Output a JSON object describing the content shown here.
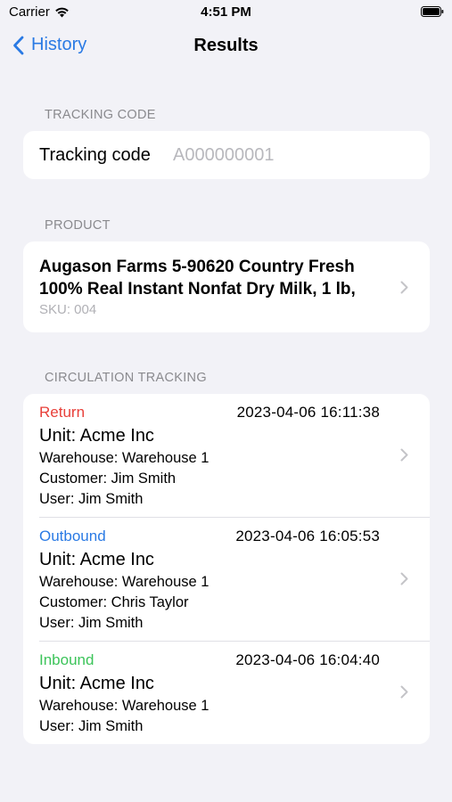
{
  "status_bar": {
    "carrier": "Carrier",
    "time": "4:51 PM"
  },
  "nav": {
    "back_label": "History",
    "title": "Results"
  },
  "tracking_section": {
    "header": "TRACKING CODE",
    "label": "Tracking code",
    "placeholder": "A000000001",
    "value": ""
  },
  "product_section": {
    "header": "PRODUCT",
    "name": "Augason Farms 5-90620 Country Fresh 100% Real Instant Nonfat Dry Milk, 1 lb,",
    "sku": "SKU: 004"
  },
  "circulation_section": {
    "header": "CIRCULATION TRACKING",
    "entries": [
      {
        "type": "Return",
        "type_color": "#e8403a",
        "datetime": "2023-04-06 16:11:38",
        "unit": "Unit:  Acme Inc",
        "warehouse": "Warehouse:  Warehouse 1",
        "customer": "Customer:  Jim Smith",
        "user": "User:  Jim Smith"
      },
      {
        "type": "Outbound",
        "type_color": "#2a7ae4",
        "datetime": "2023-04-06 16:05:53",
        "unit": "Unit:  Acme Inc",
        "warehouse": "Warehouse:  Warehouse 1",
        "customer": "Customer:  Chris Taylor",
        "user": "User:  Jim Smith"
      },
      {
        "type": "Inbound",
        "type_color": "#3cc45a",
        "datetime": "2023-04-06 16:04:40",
        "unit": "Unit:  Acme Inc",
        "warehouse": "Warehouse:  Warehouse 1",
        "user": "User:  Jim Smith"
      }
    ]
  },
  "icons": {
    "wifi": "wifi-icon",
    "battery": "battery-icon",
    "back": "chevron-left-icon",
    "disclosure": "chevron-right-icon"
  },
  "colors": {
    "background": "#f2f2f7",
    "accent": "#2a7ae4",
    "secondary_text": "#8a8a8e"
  }
}
